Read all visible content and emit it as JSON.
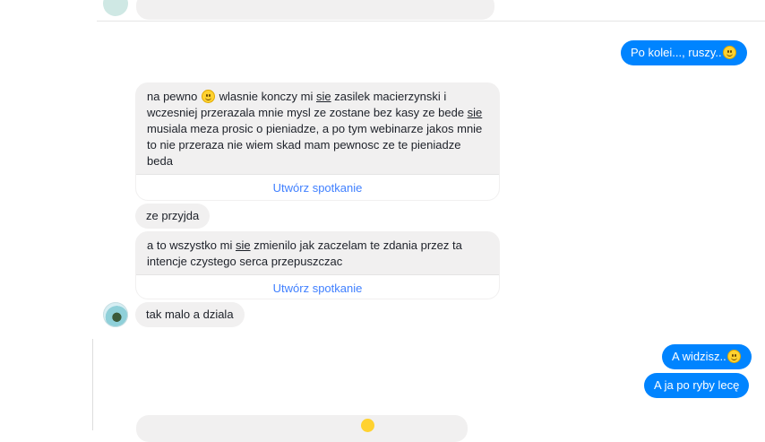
{
  "messages": {
    "out_1": "Po kolei..., ruszy..",
    "in_card_1": {
      "part_a": "na pewno",
      "part_b": " wlasnie konczy mi ",
      "sie_1": "sie",
      "part_c": " zasilek macierzynski i wczesniej przerazala mnie mysl ze zostane bez kasy ze bede ",
      "sie_2": "sie",
      "part_d": " musiala meza prosic o pieniadze, a po tym webinarze jakos mnie to nie przeraza nie wiem skad mam pewnosc ze te pieniadze beda",
      "action": "Utwórz spotkanie"
    },
    "in_2": "ze przyjda",
    "in_card_2": {
      "part_a": "a to wszystko mi ",
      "sie": "sie",
      "part_b": " zmienilo jak zaczelam te zdania przez ta intencje czystego serca przepuszczac",
      "action": "Utwórz spotkanie"
    },
    "in_3": "tak malo a dziala",
    "out_2": "A widzisz..",
    "out_3": "A ja po ryby lecę"
  },
  "icons": {
    "emoji": "slightly-smiling-face-icon",
    "avatar": "contact-avatar"
  },
  "colors": {
    "outgoing_bubble": "#0084ff",
    "incoming_bubble": "#f1f0f0",
    "action_link": "#4080ff"
  }
}
